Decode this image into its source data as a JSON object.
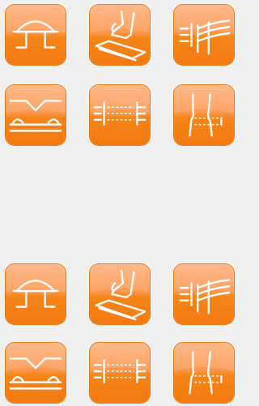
{
  "theme": {
    "tile_top": "#ffa666",
    "tile_bottom": "#f47e12",
    "stroke": "#ffffff",
    "background": "#f0f0f0"
  },
  "icon_groups": [
    {
      "icons": [
        {
          "name": "bridge-arch-icon"
        },
        {
          "name": "foot-on-board-icon"
        },
        {
          "name": "fence-lines-icon"
        },
        {
          "name": "wave-curve-icon"
        },
        {
          "name": "rail-fence-dashed-icon"
        },
        {
          "name": "split-pipe-icon"
        }
      ]
    },
    {
      "icons": [
        {
          "name": "bridge-arch-icon"
        },
        {
          "name": "foot-on-board-icon"
        },
        {
          "name": "fence-lines-icon"
        },
        {
          "name": "wave-curve-icon"
        },
        {
          "name": "rail-fence-dashed-icon"
        },
        {
          "name": "split-pipe-icon"
        }
      ]
    }
  ]
}
